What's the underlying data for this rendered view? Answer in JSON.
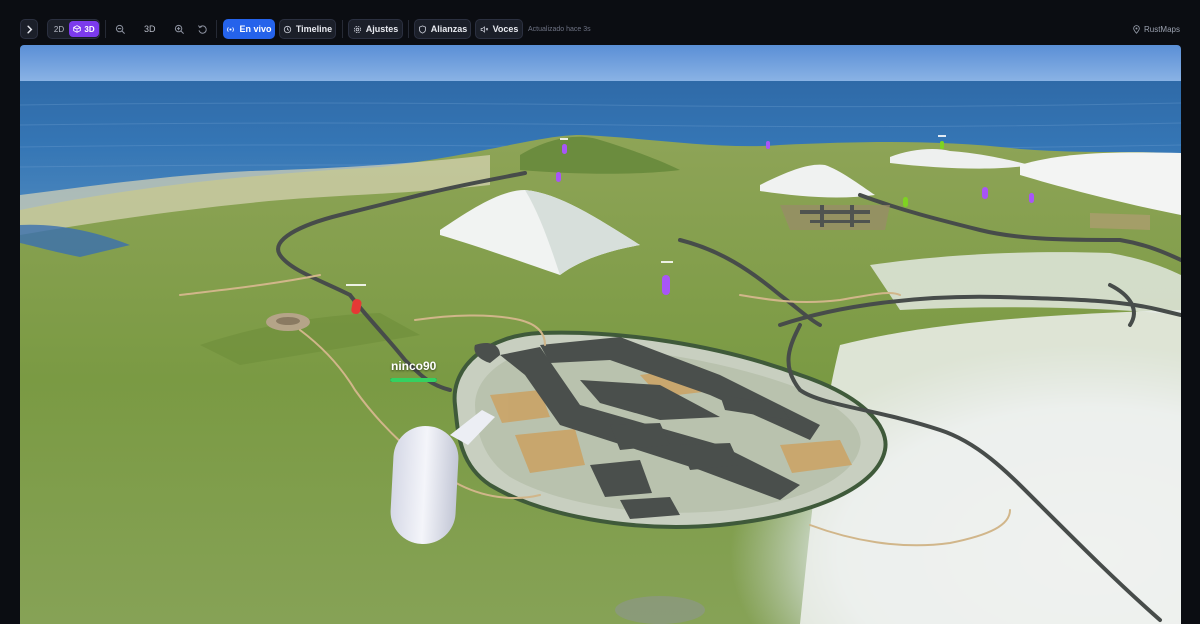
{
  "toolbar": {
    "collapse_icon": "chevron-right-icon",
    "view_2d_label": "2D",
    "view_3d_label": "3D",
    "view_mode_active": "3D",
    "zoom_out_icon": "zoom-out-icon",
    "mode_text": "3D",
    "zoom_in_icon": "zoom-in-icon",
    "reset_icon": "rotate-ccw-icon",
    "live_label": "En vivo",
    "live_icon": "broadcast-icon",
    "timeline_label": "Timeline",
    "timeline_icon": "history-icon",
    "settings_label": "Ajustes",
    "settings_icon": "gear-icon",
    "alliances_label": "Alianzas",
    "alliances_icon": "shield-icon",
    "voices_label": "Voces",
    "voices_icon": "speaker-icon",
    "status_text": "Actualizado hace 3s",
    "brand_label": "RustMaps",
    "brand_icon": "map-pin-icon"
  },
  "map": {
    "player": {
      "name": "ninco90",
      "health": 1.0
    }
  },
  "colors": {
    "accent_live": "#2563eb",
    "accent_3d": "#7c3aed",
    "health": "#34d161",
    "marker_red": "#e53935",
    "marker_purple": "#a855f7",
    "marker_green": "#7ed321"
  }
}
